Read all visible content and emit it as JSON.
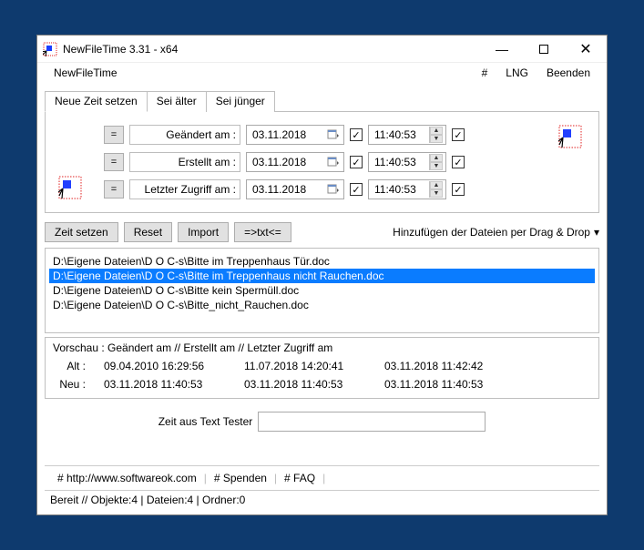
{
  "window": {
    "title": "NewFileTime 3.31 - x64"
  },
  "menubar": {
    "app": "NewFileTime",
    "items": [
      "#",
      "LNG",
      "Beenden"
    ]
  },
  "tabs": {
    "list": [
      "Neue Zeit setzen",
      "Sei älter",
      "Sei jünger"
    ],
    "active": 0
  },
  "timegrid": {
    "rows": [
      {
        "eq": "=",
        "label": "Geändert am :",
        "date": "03.11.2018",
        "checked1": true,
        "time": "11:40:53",
        "checked2": true
      },
      {
        "eq": "=",
        "label": "Erstellt am :",
        "date": "03.11.2018",
        "checked1": true,
        "time": "11:40:53",
        "checked2": true
      },
      {
        "eq": "=",
        "label": "Letzter Zugriff am :",
        "date": "03.11.2018",
        "checked1": true,
        "time": "11:40:53",
        "checked2": true
      }
    ]
  },
  "actions": {
    "setzen": "Zeit setzen",
    "reset": "Reset",
    "import": "Import",
    "txt": "=>txt<=",
    "drag": "Hinzufügen der Dateien per Drag & Drop"
  },
  "files": [
    "D:\\Eigene Dateien\\D O C-s\\Bitte im Treppenhaus Tür.doc",
    "D:\\Eigene Dateien\\D O C-s\\Bitte im Treppenhaus nicht Rauchen.doc",
    "D:\\Eigene Dateien\\D O C-s\\Bitte kein Spermüll.doc",
    "D:\\Eigene Dateien\\D O C-s\\Bitte_nicht_Rauchen.doc"
  ],
  "files_selected_index": 1,
  "preview": {
    "header": "Vorschau  :   Geändert am    //    Erstellt am    //    Letzter Zugriff am",
    "alt_label": "Alt :",
    "neu_label": "Neu :",
    "alt": [
      "09.04.2010 16:29:56",
      "11.07.2018 14:20:41",
      "03.11.2018 11:42:42"
    ],
    "neu": [
      "03.11.2018 11:40:53",
      "03.11.2018 11:40:53",
      "03.11.2018 11:40:53"
    ]
  },
  "tester": {
    "label": "Zeit aus Text Tester",
    "value": ""
  },
  "bottom": {
    "links": [
      "# http://www.softwareok.com",
      "# Spenden",
      "# FAQ"
    ]
  },
  "status": "Bereit // Objekte:4 | Dateien:4 | Ordner:0"
}
